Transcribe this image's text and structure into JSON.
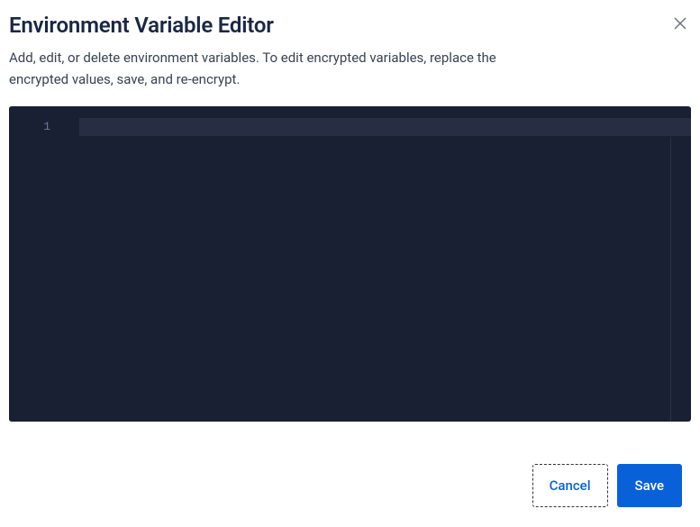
{
  "modal": {
    "title": "Environment Variable Editor",
    "description": "Add, edit, or delete environment variables. To edit encrypted variables, replace the encrypted values, save, and re-encrypt."
  },
  "editor": {
    "line_numbers": [
      "1"
    ],
    "content": ""
  },
  "footer": {
    "cancel_label": "Cancel",
    "save_label": "Save"
  }
}
